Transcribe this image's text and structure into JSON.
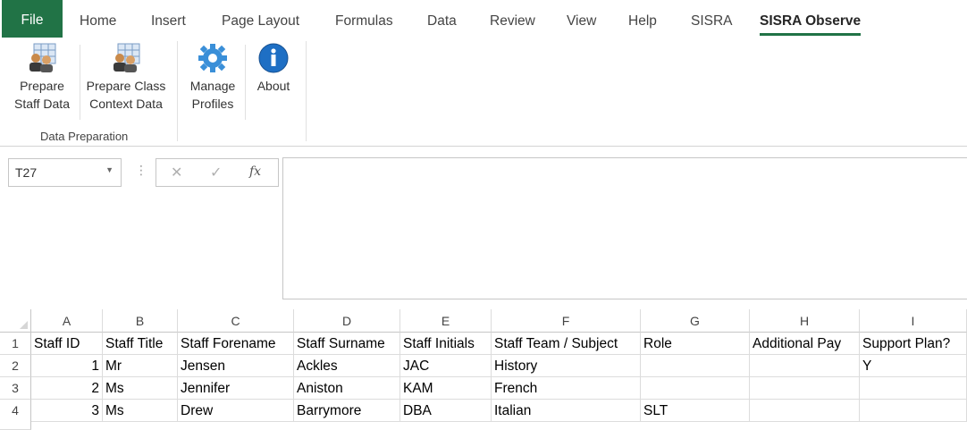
{
  "ribbon": {
    "tabs": [
      "File",
      "Home",
      "Insert",
      "Page Layout",
      "Formulas",
      "Data",
      "Review",
      "View",
      "Help",
      "SISRA",
      "SISRA Observe"
    ],
    "active_tab": "SISRA Observe",
    "buttons": {
      "prepare_staff": [
        "Prepare",
        "Staff Data"
      ],
      "prepare_class": [
        "Prepare Class",
        "Context Data"
      ],
      "manage_profiles": [
        "Manage",
        "Profiles"
      ],
      "about": [
        "About"
      ]
    },
    "group_label": "Data Preparation",
    "icons": [
      "people-data-icon",
      "people-data-icon",
      "gear-icon",
      "info-icon"
    ]
  },
  "formula_bar": {
    "name_box": "T27",
    "cancel_icon": "✕",
    "enter_icon": "✓",
    "fx_label": "fx",
    "formula": ""
  },
  "sheet": {
    "columns": [
      "A",
      "B",
      "C",
      "D",
      "E",
      "F",
      "G",
      "H",
      "I"
    ],
    "rows": [
      "1",
      "2",
      "3",
      "4"
    ],
    "cells": [
      [
        "Staff ID",
        "Staff Title",
        "Staff Forename",
        "Staff Surname",
        "Staff Initials",
        "Staff Team / Subject",
        "Role",
        "Additional Pay",
        "Support Plan?"
      ],
      [
        "1",
        "Mr",
        "Jensen",
        "Ackles",
        "JAC",
        "History",
        "",
        "",
        "Y"
      ],
      [
        "2",
        "Ms",
        "Jennifer",
        "Aniston",
        "KAM",
        "French",
        "",
        "",
        ""
      ],
      [
        "3",
        "Ms",
        "Drew",
        "Barrymore",
        "DBA",
        "Italian",
        "SLT",
        "",
        ""
      ]
    ]
  },
  "colors": {
    "excel_green": "#217346",
    "gear_blue": "#3a8fd8",
    "info_blue": "#1e6fc4"
  }
}
